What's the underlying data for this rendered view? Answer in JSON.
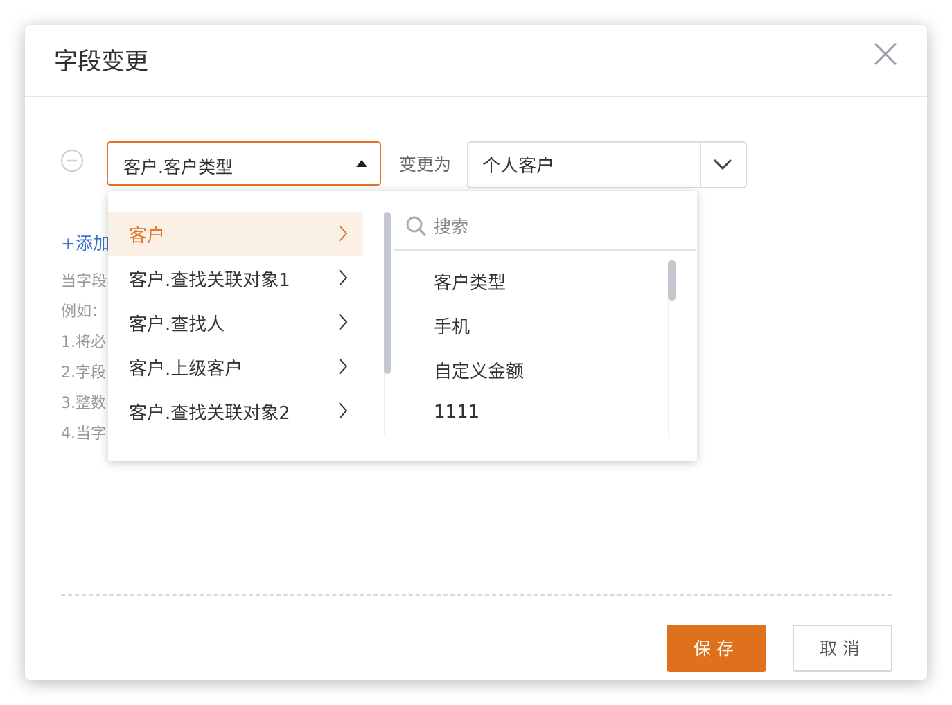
{
  "dialog": {
    "title": "字段变更",
    "close_icon": "close-icon"
  },
  "rule": {
    "remove_icon": "minus-circle-icon",
    "field_value": "客户.客户类型",
    "change_label": "变更为",
    "target_value": "个人客户"
  },
  "add_link": "+添加",
  "hints": [
    "当字段",
    "例如：",
    "1.将必",
    "2.字段",
    "3.整数",
    "4.当字"
  ],
  "dropdown": {
    "objects": [
      {
        "label": "客户",
        "active": true
      },
      {
        "label": "客户.查找关联对象1",
        "active": false
      },
      {
        "label": "客户.查找人",
        "active": false
      },
      {
        "label": "客户.上级客户",
        "active": false
      },
      {
        "label": "客户.查找关联对象2",
        "active": false
      }
    ],
    "search_placeholder": "搜索",
    "fields": [
      "客户类型",
      "手机",
      "自定义金额",
      "1111"
    ]
  },
  "footer": {
    "save_label": "保存",
    "cancel_label": "取消"
  },
  "colors": {
    "accent": "#e0711c",
    "link": "#3d6fcf",
    "active_bg": "#fbf0e6"
  }
}
